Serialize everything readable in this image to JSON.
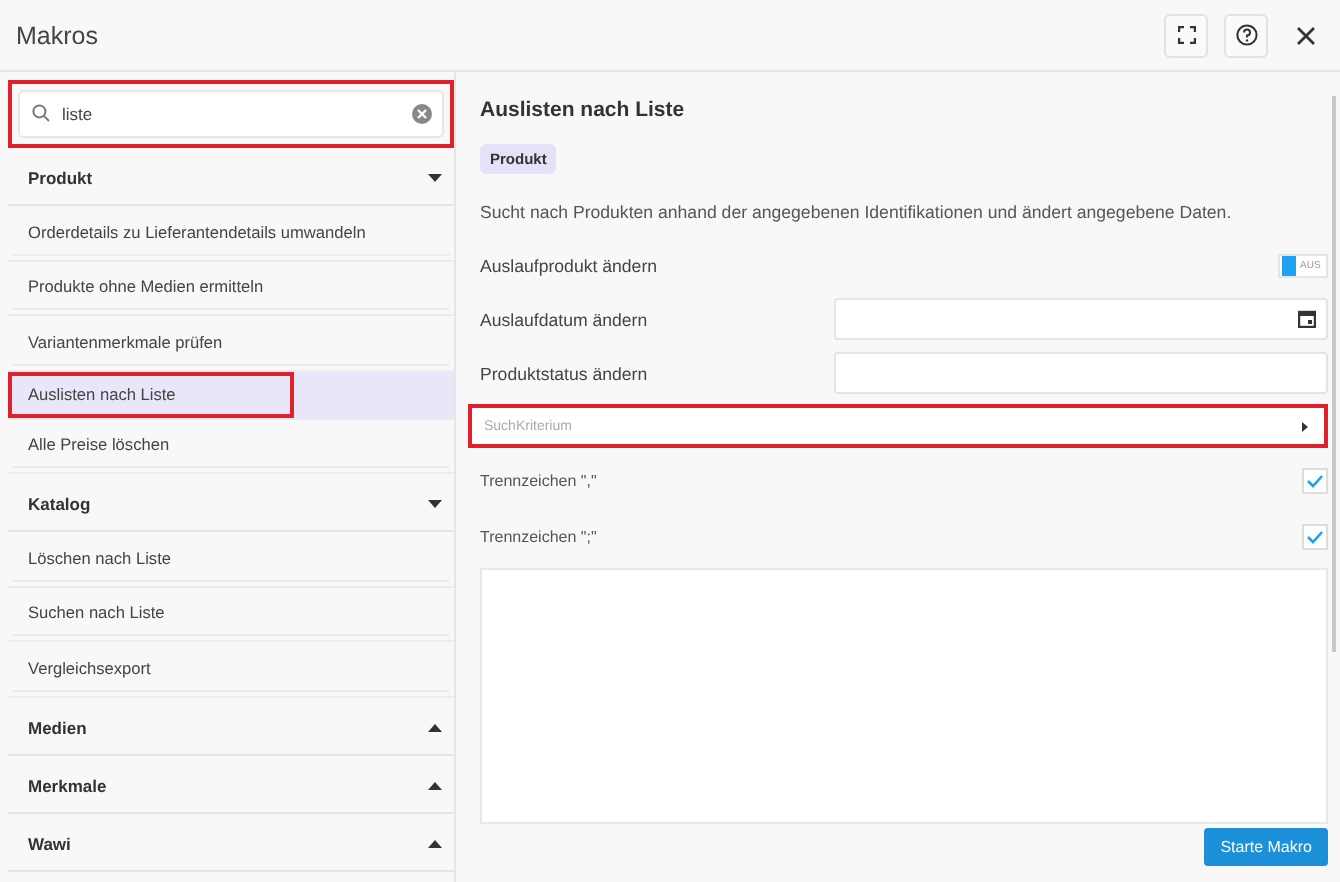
{
  "window": {
    "title": "Makros"
  },
  "search": {
    "value": "liste",
    "highlighted": true
  },
  "groups": [
    {
      "title": "Produkt",
      "expanded": true,
      "items": [
        {
          "label": "Orderdetails zu Lieferantendetails umwandeln",
          "selected": false,
          "highlighted": false
        },
        {
          "label": "Produkte ohne Medien ermitteln",
          "selected": false,
          "highlighted": false
        },
        {
          "label": "Variantenmerkmale prüfen",
          "selected": false,
          "highlighted": false
        },
        {
          "label": "Auslisten nach Liste",
          "selected": true,
          "highlighted": true
        },
        {
          "label": "Alle Preise löschen",
          "selected": false,
          "highlighted": false
        }
      ]
    },
    {
      "title": "Katalog",
      "expanded": true,
      "items": [
        {
          "label": "Löschen nach Liste",
          "selected": false,
          "highlighted": false
        },
        {
          "label": "Suchen nach Liste",
          "selected": false,
          "highlighted": false
        },
        {
          "label": "Vergleichsexport",
          "selected": false,
          "highlighted": false
        }
      ]
    },
    {
      "title": "Medien",
      "expanded": false
    },
    {
      "title": "Merkmale",
      "expanded": false
    },
    {
      "title": "Wawi",
      "expanded": false
    }
  ],
  "detail": {
    "title": "Auslisten nach Liste",
    "tag": "Produkt",
    "description": "Sucht nach Produkten anhand der angegebenen Identifikationen und ändert angegebene Daten.",
    "fields": [
      {
        "kind": "switch",
        "label": "Auslaufprodukt ändern",
        "on": false,
        "state_text": "AUS"
      },
      {
        "kind": "date",
        "label": "Auslaufdatum ändern"
      },
      {
        "kind": "text",
        "label": "Produktstatus ändern"
      },
      {
        "kind": "expander",
        "placeholder": "SuchKriterium",
        "highlighted": true
      },
      {
        "kind": "checkbox",
        "label": "Trennzeichen \",\"",
        "checked": true
      },
      {
        "kind": "checkbox",
        "label": "Trennzeichen \";\"",
        "checked": true
      },
      {
        "kind": "textarea"
      }
    ]
  },
  "buttons": [
    "Starte Makro"
  ]
}
